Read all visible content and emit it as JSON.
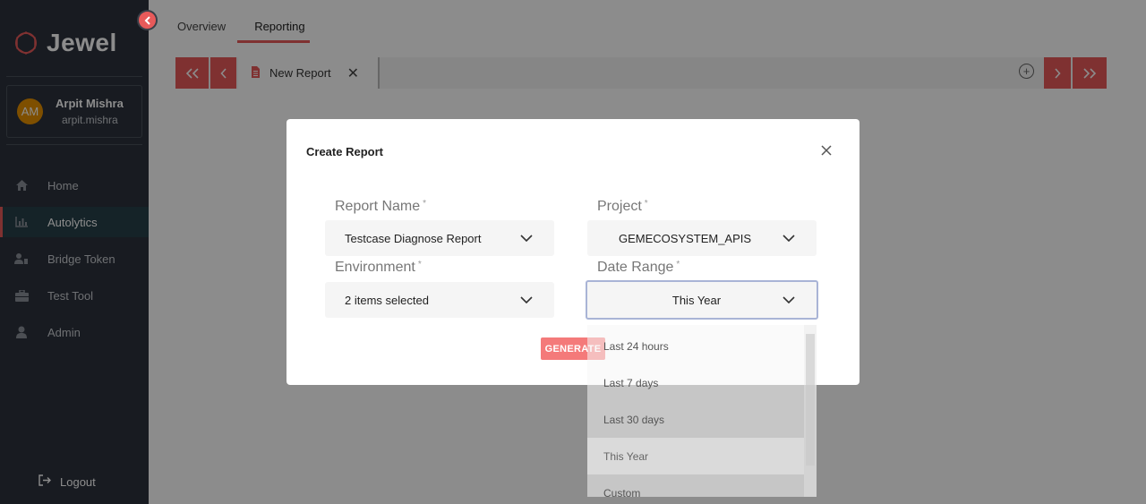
{
  "app": {
    "name": "Jewel",
    "brand_color": "#e85a5a"
  },
  "user": {
    "initials": "AM",
    "name": "Arpit Mishra",
    "handle": "arpit.mishra"
  },
  "sidebar": {
    "items": [
      {
        "label": "Home",
        "icon": "home-icon"
      },
      {
        "label": "Autolytics",
        "icon": "chart-icon",
        "active": true
      },
      {
        "label": "Bridge Token",
        "icon": "user-key-icon"
      },
      {
        "label": "Test Tool",
        "icon": "toolbox-icon"
      },
      {
        "label": "Admin",
        "icon": "user-icon"
      }
    ],
    "logout_label": "Logout"
  },
  "tabs": [
    {
      "label": "Overview"
    },
    {
      "label": "Reporting",
      "active": true
    }
  ],
  "toolbar": {
    "report_tab_label": "New Report"
  },
  "modal": {
    "title": "Create Report",
    "fields": {
      "report_name": {
        "label": "Report Name",
        "required_mark": "*",
        "value": "Testcase Diagnose Report"
      },
      "project": {
        "label": "Project",
        "required_mark": "*",
        "value": "GEMECOSYSTEM_APIS"
      },
      "environment": {
        "label": "Environment",
        "required_mark": "*",
        "value": "2 items selected"
      },
      "date_range": {
        "label": "Date Range",
        "required_mark": "*",
        "value": "This Year"
      }
    },
    "generate_label": "GENERATE"
  },
  "date_range_options": [
    {
      "label": "Last 24 hours"
    },
    {
      "label": "Last 7 days"
    },
    {
      "label": "Last 30 days"
    },
    {
      "label": "This Year",
      "selected": true
    },
    {
      "label": "Custom"
    }
  ]
}
